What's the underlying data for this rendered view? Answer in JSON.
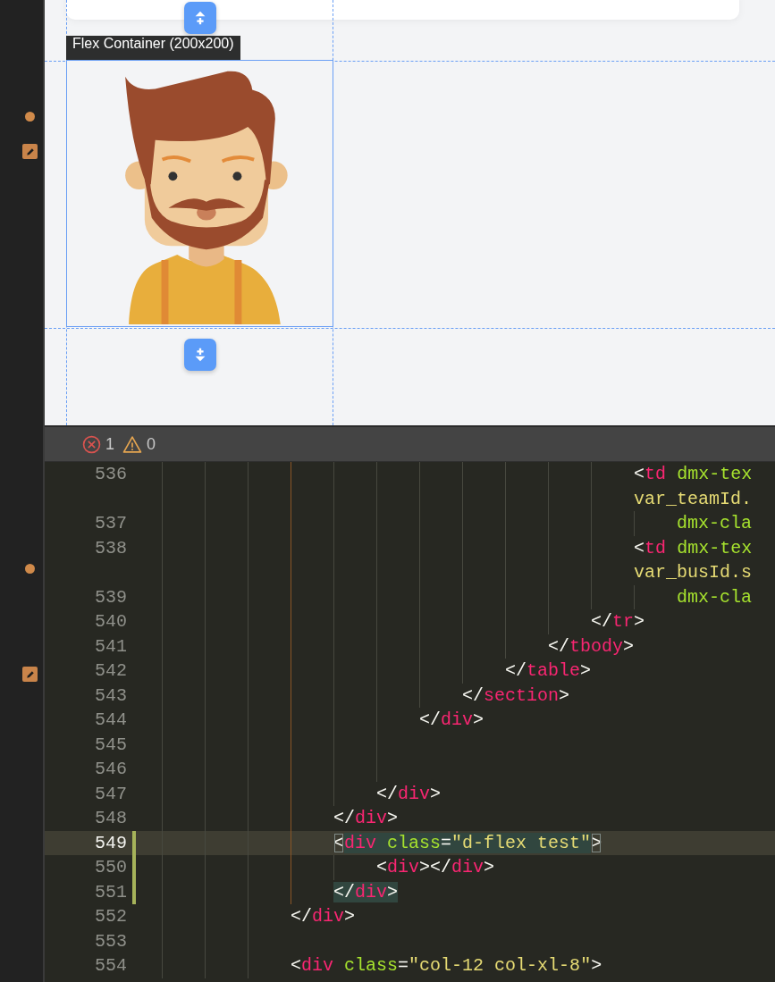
{
  "preview": {
    "container_label": "Flex Container (200x200)"
  },
  "problems": {
    "errors": "1",
    "warnings": "0"
  },
  "editor": {
    "rows": [
      {
        "number": "536",
        "current": false,
        "modified": false,
        "tokens": [
          {
            "kind": "punct",
            "text": "                                            <"
          },
          {
            "kind": "tag",
            "text": "td"
          },
          {
            "kind": "attr",
            "text": " dmx-tex"
          }
        ]
      },
      {
        "current": false,
        "modified": false,
        "tokens": [
          {
            "kind": "string",
            "text": "                                            var_teamId."
          }
        ]
      },
      {
        "number": "537",
        "current": false,
        "modified": false,
        "tokens": [
          {
            "kind": "attr",
            "text": "                                                dmx-cla"
          }
        ]
      },
      {
        "number": "538",
        "current": false,
        "modified": false,
        "tokens": [
          {
            "kind": "punct",
            "text": "                                            <"
          },
          {
            "kind": "tag",
            "text": "td"
          },
          {
            "kind": "attr",
            "text": " dmx-tex"
          }
        ]
      },
      {
        "current": false,
        "modified": false,
        "tokens": [
          {
            "kind": "string",
            "text": "                                            var_busId.s"
          }
        ]
      },
      {
        "number": "539",
        "current": false,
        "modified": false,
        "tokens": [
          {
            "kind": "attr",
            "text": "                                                dmx-cla"
          }
        ]
      },
      {
        "number": "540",
        "current": false,
        "modified": false,
        "tokens": [
          {
            "kind": "punct",
            "text": "                                        </"
          },
          {
            "kind": "tag",
            "text": "tr"
          },
          {
            "kind": "punct",
            "text": ">"
          }
        ]
      },
      {
        "number": "541",
        "current": false,
        "modified": false,
        "tokens": [
          {
            "kind": "punct",
            "text": "                                    </"
          },
          {
            "kind": "tag",
            "text": "tbody"
          },
          {
            "kind": "punct",
            "text": ">"
          }
        ]
      },
      {
        "number": "542",
        "current": false,
        "modified": false,
        "tokens": [
          {
            "kind": "punct",
            "text": "                                </"
          },
          {
            "kind": "tag",
            "text": "table"
          },
          {
            "kind": "punct",
            "text": ">"
          }
        ]
      },
      {
        "number": "543",
        "current": false,
        "modified": false,
        "tokens": [
          {
            "kind": "punct",
            "text": "                            </"
          },
          {
            "kind": "tag",
            "text": "section"
          },
          {
            "kind": "punct",
            "text": ">"
          }
        ]
      },
      {
        "number": "544",
        "current": false,
        "modified": false,
        "tokens": [
          {
            "kind": "punct",
            "text": "                        </"
          },
          {
            "kind": "tag",
            "text": "div"
          },
          {
            "kind": "punct",
            "text": ">"
          }
        ]
      },
      {
        "number": "545",
        "current": false,
        "modified": false
      },
      {
        "number": "546",
        "current": false,
        "modified": false
      },
      {
        "number": "547",
        "current": false,
        "modified": false,
        "tokens": [
          {
            "kind": "punct",
            "text": "                    </"
          },
          {
            "kind": "tag",
            "text": "div"
          },
          {
            "kind": "punct",
            "text": ">"
          }
        ]
      },
      {
        "number": "548",
        "current": false,
        "modified": false,
        "tokens": [
          {
            "kind": "punct",
            "text": "                </"
          },
          {
            "kind": "tag",
            "text": "div"
          },
          {
            "kind": "punct",
            "text": ">"
          }
        ]
      },
      {
        "number": "549",
        "current": true,
        "modified": true,
        "tokens": [
          {
            "kind": "bracket",
            "text": "                <"
          },
          {
            "kind": "match",
            "tokens": [
              {
                "kind": "tag",
                "text": "div"
              },
              {
                "kind": "attr",
                "text": " class"
              },
              {
                "kind": "punct",
                "text": "="
              },
              {
                "kind": "string",
                "text": "\"d-flex test\""
              }
            ]
          },
          {
            "kind": "bracket",
            "text": ">"
          }
        ]
      },
      {
        "number": "550",
        "current": false,
        "modified": true,
        "tokens": [
          {
            "kind": "punct",
            "text": "                    <"
          },
          {
            "kind": "tag",
            "text": "div"
          },
          {
            "kind": "punct",
            "text": "></"
          },
          {
            "kind": "tag",
            "text": "div"
          },
          {
            "kind": "punct",
            "text": ">"
          }
        ]
      },
      {
        "number": "551",
        "current": false,
        "modified": true,
        "tokens": [
          {
            "kind": "match",
            "tokens": [
              {
                "kind": "punct",
                "text": "                </"
              },
              {
                "kind": "tag",
                "text": "div"
              },
              {
                "kind": "punct",
                "text": ">"
              }
            ]
          }
        ]
      },
      {
        "number": "552",
        "current": false,
        "modified": false,
        "tokens": [
          {
            "kind": "punct",
            "text": "            </"
          },
          {
            "kind": "tag",
            "text": "div"
          },
          {
            "kind": "punct",
            "text": ">"
          }
        ]
      },
      {
        "number": "553",
        "current": false,
        "modified": false
      },
      {
        "number": "554",
        "current": false,
        "modified": false,
        "tokens": [
          {
            "kind": "punct",
            "text": "            <"
          },
          {
            "kind": "tag",
            "text": "div"
          },
          {
            "kind": "attr",
            "text": " class"
          },
          {
            "kind": "punct",
            "text": "="
          },
          {
            "kind": "string",
            "text": "\"col-12 col-xl-8\""
          },
          {
            "kind": "punct",
            "text": ">"
          }
        ]
      }
    ]
  }
}
